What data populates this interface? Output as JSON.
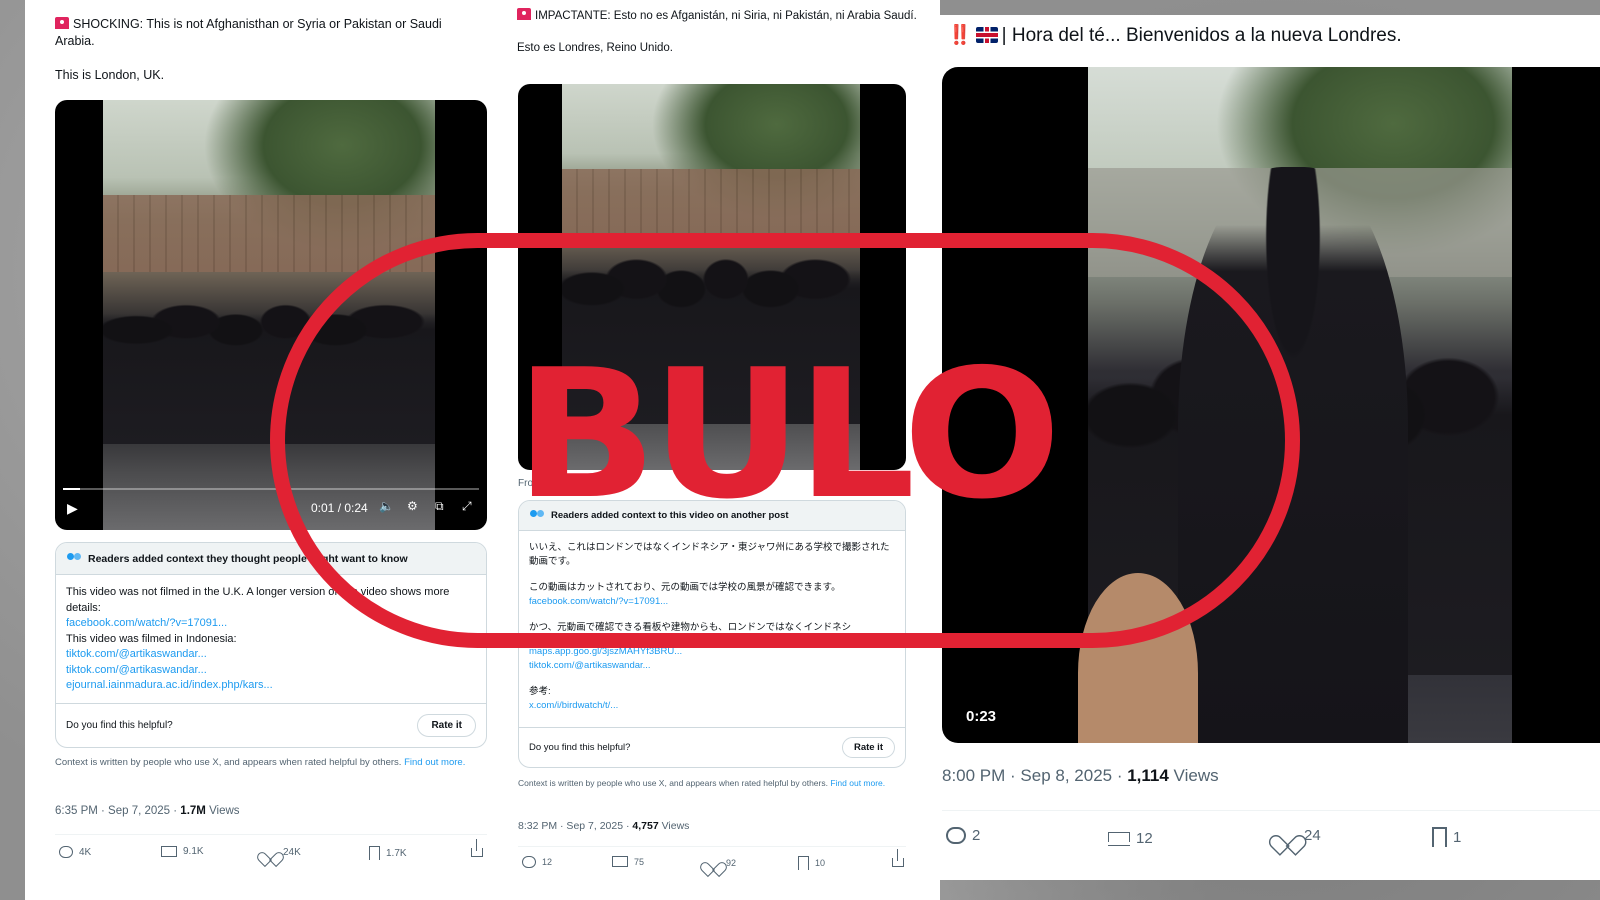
{
  "stamp": {
    "label": "BULO",
    "color": "#e12233"
  },
  "posts": [
    {
      "text_line1": "SHOCKING: This is not Afghanisthan or Syria or Pakistan or Saudi Arabia.",
      "text_line2": "This is London, UK.",
      "video": {
        "time": "0:01 / 0:24",
        "progress": 0.04
      },
      "note": {
        "header": "Readers added context they thought people might want to know",
        "body1": "This video was not filmed in the U.K. A longer version of this video shows more details:",
        "link1": "facebook.com/watch/?v=17091...",
        "body2": "This video was filmed in Indonesia:",
        "link2": "tiktok.com/@artikaswandar...",
        "link3": "tiktok.com/@artikaswandar...",
        "link4": "ejournal.iainmadura.ac.id/index.php/kars...",
        "question": "Do you find this helpful?",
        "rate": "Rate it"
      },
      "disclaimer": "Context is written by people who use X, and appears when rated helpful by others.",
      "find_out": "Find out more.",
      "meta_time": "6:35 PM · Sep 7, 2025 · ",
      "meta_views": "1.7M",
      "meta_views_label": " Views",
      "stats": {
        "replies": "4K",
        "reposts": "9.1K",
        "likes": "24K",
        "bookmarks": "1.7K"
      }
    },
    {
      "text_line1": "IMPACTANTE: Esto no es Afganistán, ni Siria, ni Pakistán, ni Arabia Saudí.",
      "text_line2": "Esto es Londres, Reino Unido.",
      "from_label": "Fro",
      "note": {
        "header": "Readers added context to this video on another post",
        "body1": "いいえ、これはロンドンではなくインドネシア・東ジャワ州にある学校で撮影された動画です。",
        "body2": "この動画はカットされており、元の動画では学校の風景が確認できます。",
        "link1": "facebook.com/watch/?v=17091...",
        "body3": "かつ、元動画で確認できる看板や建物からも、ロンドンではなくインドネシ",
        "link2": "maps.app.goo.gl/3jszMAHYf3BRU...",
        "link3": "tiktok.com/@artikaswandar...",
        "ref": "参考:",
        "link4": "x.com/i/birdwatch/t/...",
        "question": "Do you find this helpful?",
        "rate": "Rate it"
      },
      "disclaimer": "Context is written by people who use X, and appears when rated helpful by others.",
      "find_out": "Find out more.",
      "meta_time": "8:32 PM · Sep 7, 2025 · ",
      "meta_views": "4,757",
      "meta_views_label": " Views",
      "stats": {
        "replies": "12",
        "reposts": "75",
        "likes": "92",
        "bookmarks": "10"
      }
    },
    {
      "prefix": "‼️",
      "text": "| Hora del té... Bienvenidos a la nueva Londres.",
      "video": {
        "time": "0:23"
      },
      "meta_time": "8:00 PM · Sep 8, 2025 · ",
      "meta_views": "1,114",
      "meta_views_label": " Views",
      "stats": {
        "replies": "2",
        "reposts": "12",
        "likes": "24",
        "bookmarks": "1"
      }
    }
  ]
}
